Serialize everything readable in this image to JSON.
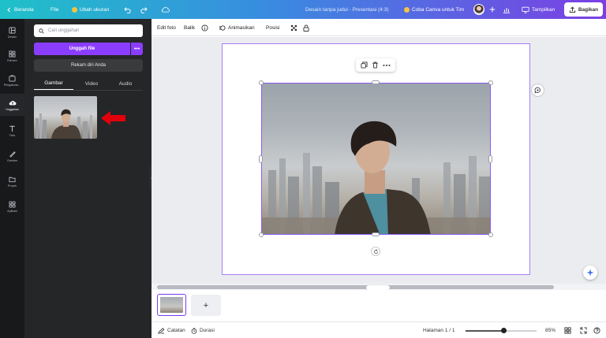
{
  "topbar": {
    "home": "Beranda",
    "file": "File",
    "resize": "Ubah ukuran",
    "doc_title": "Desain tanpa judul - Presentasi (4:3)",
    "try_canva": "Coba Canva untuk Tim",
    "present": "Tampilkan",
    "share": "Bagikan"
  },
  "rail": {
    "items": [
      {
        "label": "Desain",
        "icon": "layout-icon"
      },
      {
        "label": "Elemen",
        "icon": "shapes-icon"
      },
      {
        "label": "Pengaturan...",
        "icon": "brand-icon"
      },
      {
        "label": "Unggahan",
        "icon": "cloud-upload-icon"
      },
      {
        "label": "Teks",
        "icon": "text-icon"
      },
      {
        "label": "Gambar",
        "icon": "draw-icon"
      },
      {
        "label": "Proyek",
        "icon": "folder-icon"
      },
      {
        "label": "Aplikasi",
        "icon": "apps-icon"
      }
    ]
  },
  "panel": {
    "search_placeholder": "Cari unggahan",
    "upload_label": "Unggah file",
    "more_label": "•••",
    "record_label": "Rekam diri Anda",
    "tabs": [
      "Gambar",
      "Video",
      "Audio"
    ]
  },
  "toolbar": {
    "edit_photo": "Edit foto",
    "flip": "Balik",
    "animate": "Animasikan",
    "position": "Posisi"
  },
  "pages": {
    "add_label": "+"
  },
  "bottombar": {
    "notes": "Catatan",
    "duration": "Durasi",
    "page_indicator": "Halaman 1 / 1",
    "zoom": "85%",
    "zoom_fraction": 0.54
  },
  "colors": {
    "accent": "#8b3dff",
    "arrow": "#e3000b"
  }
}
